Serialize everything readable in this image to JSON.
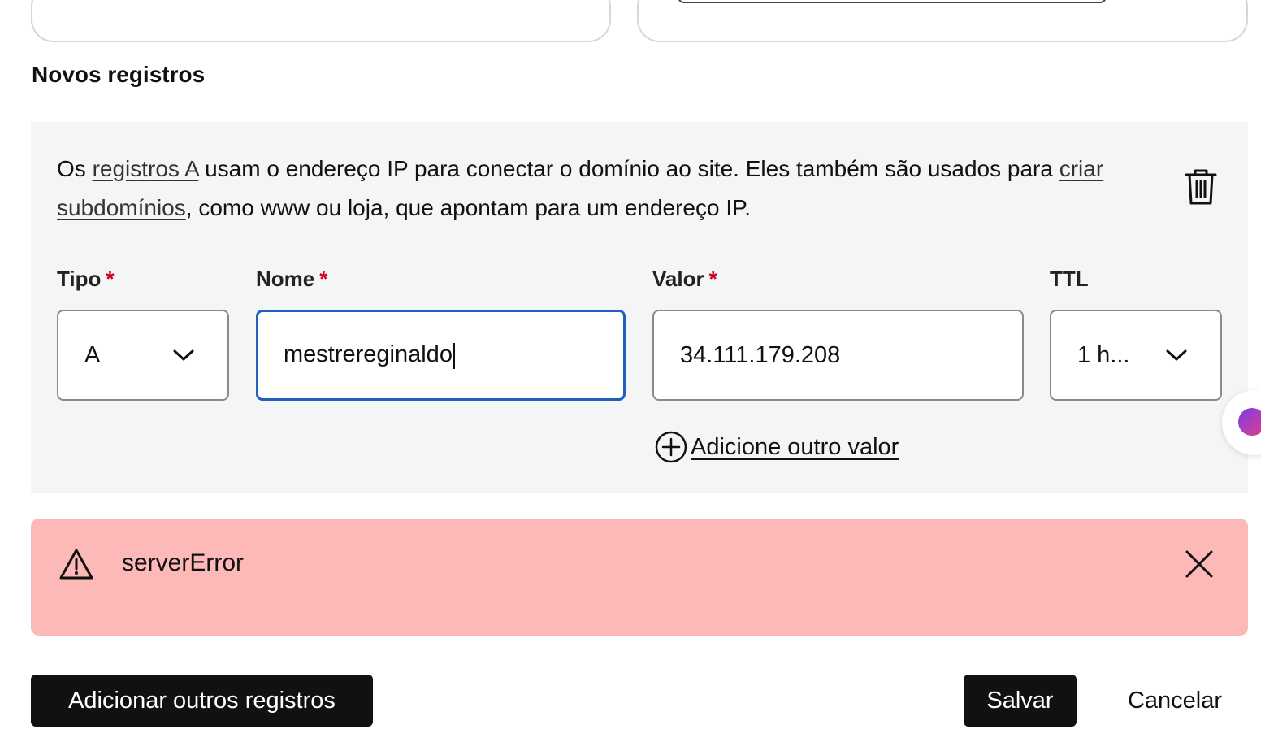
{
  "section_title": "Novos registros",
  "description": {
    "part1": "Os ",
    "link1": "registros A",
    "part2": " usam o endereço IP para conectar o domínio ao site. Eles também são usados para ",
    "link2": "criar subdomínios",
    "part3": ", como www ou loja, que apontam para um endereço IP."
  },
  "fields": {
    "tipo": {
      "label": "Tipo",
      "required_mark": "*",
      "value": "A"
    },
    "nome": {
      "label": "Nome",
      "required_mark": "*",
      "value": "mestrereginaldo"
    },
    "valor": {
      "label": "Valor",
      "required_mark": "*",
      "value": "34.111.179.208"
    },
    "ttl": {
      "label": "TTL",
      "value": "1 h..."
    }
  },
  "add_value_link": "Adicione outro valor",
  "alert": {
    "message": "serverError",
    "background": "#fdb8b8"
  },
  "buttons": {
    "add_records": "Adicionar outros registros",
    "save": "Salvar",
    "cancel": "Cancelar"
  },
  "icons": [
    "trash-icon",
    "chevron-down-icon",
    "plus-circle-icon",
    "warning-icon",
    "close-icon"
  ],
  "colors": {
    "focus_border": "#1f5fbf",
    "required": "#d0021b",
    "panel_bg": "#f4f5f7",
    "button_dark": "#111111"
  }
}
